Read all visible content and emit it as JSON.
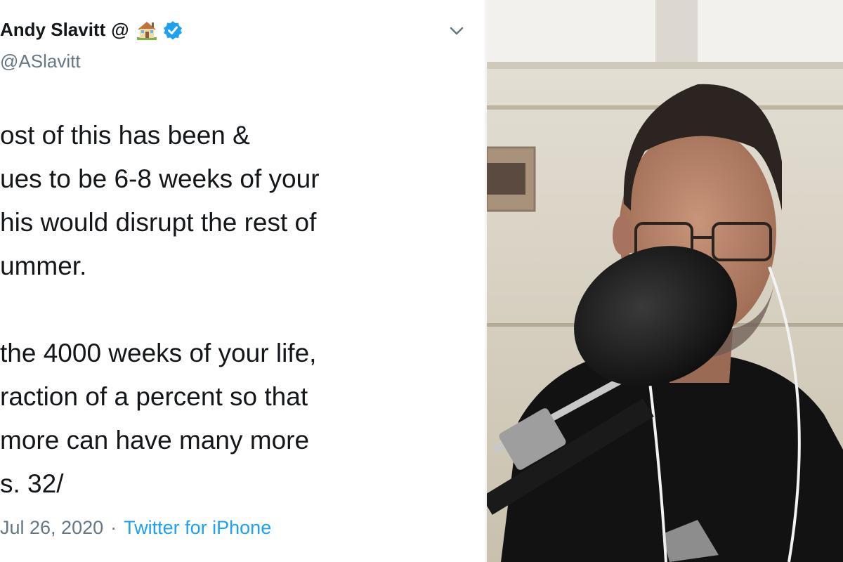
{
  "tweet": {
    "author_name": "Andy Slavitt",
    "author_at": "@",
    "handle": "@ASlavitt",
    "lines": [
      "ost of this has been &",
      "ues to be 6-8 weeks of your",
      "his would disrupt the rest of",
      "ummer.",
      "",
      " the 4000 weeks of your life,",
      "raction of a percent so that",
      " more can have many more",
      "s. 32/"
    ],
    "date": "Jul 26, 2020",
    "separator": "·",
    "source": "Twitter for iPhone",
    "accent_color": "#1da1f2",
    "icons": [
      "house-emoji-icon",
      "verified-badge-icon",
      "chevron-down-icon"
    ]
  },
  "video": {
    "subject": "man with glasses speaking into a podcast microphone"
  }
}
